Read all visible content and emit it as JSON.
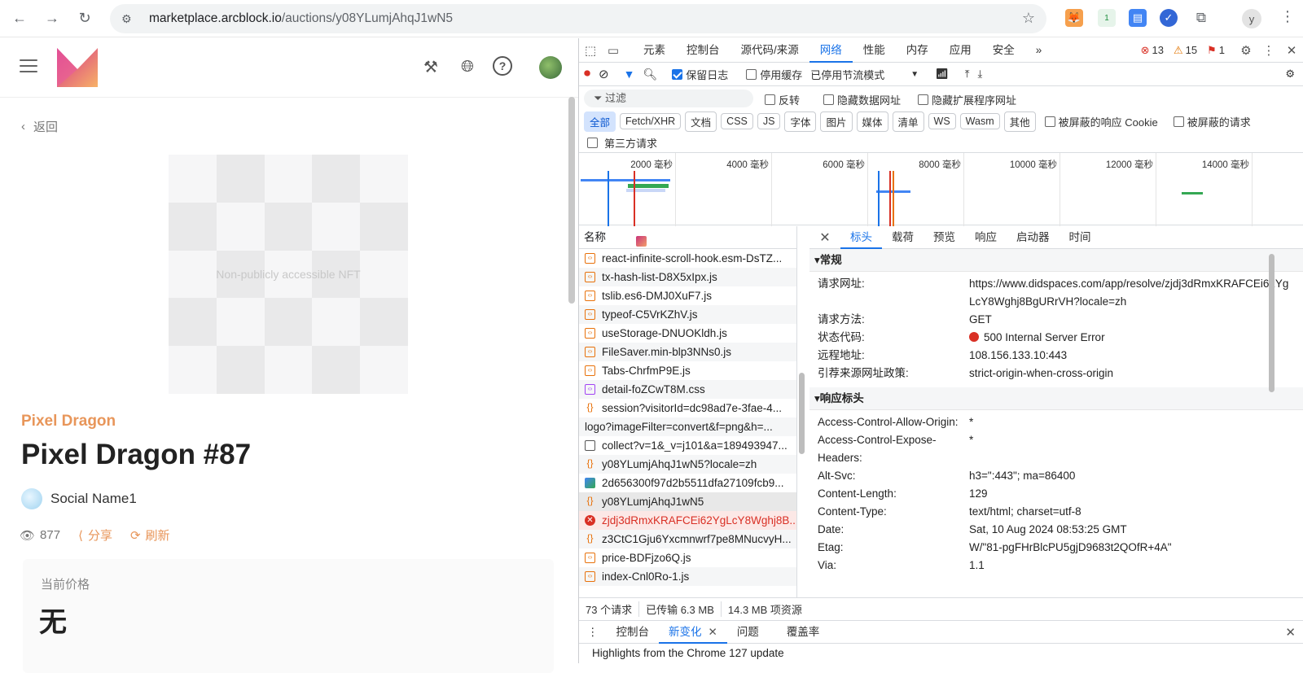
{
  "browser": {
    "url_host": "marketplace.arcblock.io",
    "url_path": "/auctions/y08YLumjAhqJ1wN5",
    "ext_badge": "1",
    "profile_initial": "y"
  },
  "page": {
    "back_label": "返回",
    "nft_placeholder": "Non-publicly accessible NFT",
    "collection": "Pixel Dragon",
    "title": "Pixel Dragon #87",
    "owner": "Social Name1",
    "views": "877",
    "share_label": "分享",
    "refresh_label": "刷新",
    "price_label": "当前价格",
    "price_value": "无"
  },
  "devtools": {
    "tabs": [
      "元素",
      "控制台",
      "源代码/来源",
      "网络",
      "性能",
      "内存",
      "应用",
      "安全"
    ],
    "more": "»",
    "errors": "13",
    "warnings": "15",
    "issues": "1",
    "toolbar": {
      "preserve_log": "保留日志",
      "disable_cache": "停用缓存",
      "throttle": "已停用节流模式"
    },
    "filter": {
      "placeholder": "过滤",
      "invert": "反转",
      "hide_data": "隐藏数据网址",
      "hide_ext": "隐藏扩展程序网址"
    },
    "types": [
      "全部",
      "Fetch/XHR",
      "文档",
      "CSS",
      "JS",
      "字体",
      "图片",
      "媒体",
      "清单",
      "WS",
      "Wasm",
      "其他"
    ],
    "blocked_cookie": "被屏蔽的响应 Cookie",
    "blocked_req": "被屏蔽的请求",
    "third_party": "第三方请求",
    "timeline_ticks": [
      "2000 毫秒",
      "4000 毫秒",
      "6000 毫秒",
      "8000 毫秒",
      "10000 毫秒",
      "12000 毫秒",
      "14000 毫秒"
    ],
    "list_header": "名称",
    "requests": [
      {
        "name": "react-infinite-scroll-hook.esm-DsTZ...",
        "type": "js"
      },
      {
        "name": "tx-hash-list-D8X5xIpx.js",
        "type": "js"
      },
      {
        "name": "tslib.es6-DMJ0XuF7.js",
        "type": "js"
      },
      {
        "name": "typeof-C5VrKZhV.js",
        "type": "js"
      },
      {
        "name": "useStorage-DNUOKldh.js",
        "type": "js"
      },
      {
        "name": "FileSaver.min-blp3NNs0.js",
        "type": "js"
      },
      {
        "name": "Tabs-ChrfmP9E.js",
        "type": "js"
      },
      {
        "name": "detail-foZCwT8M.css",
        "type": "css"
      },
      {
        "name": "session?visitorId=dc98ad7e-3fae-4...",
        "type": "json"
      },
      {
        "name": "logo?imageFilter=convert&f=png&h=...",
        "type": "logo"
      },
      {
        "name": "collect?v=1&_v=j101&a=189493947...",
        "type": "doc"
      },
      {
        "name": "y08YLumjAhqJ1wN5?locale=zh",
        "type": "json"
      },
      {
        "name": "2d656300f97d2b5511dfa27109fcb9...",
        "type": "img"
      },
      {
        "name": "y08YLumjAhqJ1wN5",
        "type": "json"
      },
      {
        "name": "zjdj3dRmxKRAFCEi62YgLcY8Wghj8B...",
        "type": "err"
      },
      {
        "name": "z3CtC1Gju6Yxcmnwrf7pe8MNucvyH...",
        "type": "json"
      },
      {
        "name": "price-BDFjzo6Q.js",
        "type": "js"
      },
      {
        "name": "index-Cnl0Ro-1.js",
        "type": "js"
      }
    ],
    "status": {
      "count": "73 个请求",
      "transferred": "已传输 6.3 MB",
      "resources": "14.3 MB 项资源"
    },
    "detail_tabs": [
      "标头",
      "载荷",
      "预览",
      "响应",
      "启动器",
      "时间"
    ],
    "general_title": "▾常规",
    "general": [
      {
        "k": "请求网址:",
        "v": "https://www.didspaces.com/app/resolve/zjdj3dRmxKRAFCEi62YgLcY8Wghj8BgURrVH?locale=zh"
      },
      {
        "k": "请求方法:",
        "v": "GET"
      },
      {
        "k": "状态代码:",
        "v": "500 Internal Server Error",
        "dot": true
      },
      {
        "k": "远程地址:",
        "v": "108.156.133.10:443"
      },
      {
        "k": "引荐来源网址政策:",
        "v": "strict-origin-when-cross-origin"
      }
    ],
    "response_title": "▾响应标头",
    "response": [
      {
        "k": "Access-Control-Allow-Origin:",
        "v": "*"
      },
      {
        "k": "Access-Control-Expose-Headers:",
        "v": "*"
      },
      {
        "k": "Alt-Svc:",
        "v": "h3=\":443\"; ma=86400"
      },
      {
        "k": "Content-Length:",
        "v": "129"
      },
      {
        "k": "Content-Type:",
        "v": "text/html; charset=utf-8"
      },
      {
        "k": "Date:",
        "v": "Sat, 10 Aug 2024 08:53:25 GMT"
      },
      {
        "k": "Etag:",
        "v": "W/\"81-pgFHrBlcPU5gjD9683t2QOfR+4A\""
      },
      {
        "k": "Via:",
        "v": "1.1"
      }
    ],
    "drawer_tabs": [
      "控制台",
      "新变化",
      "问题",
      "覆盖率"
    ],
    "drawer_text": "Highlights from the Chrome 127 update"
  }
}
